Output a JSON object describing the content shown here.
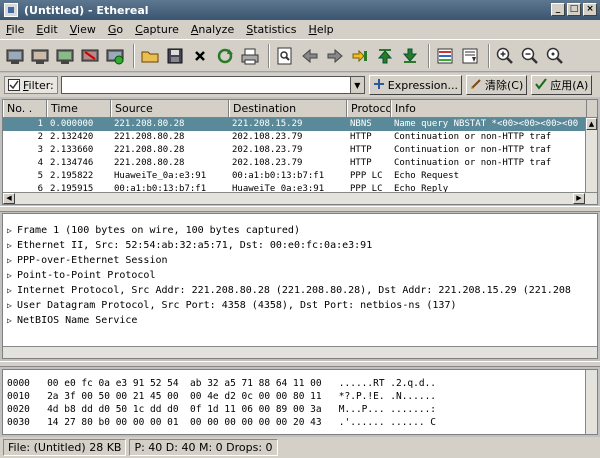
{
  "window": {
    "title": "(Untitled) - Ethereal"
  },
  "menu": [
    {
      "pre": "",
      "key": "F",
      "post": "ile"
    },
    {
      "pre": "",
      "key": "E",
      "post": "dit"
    },
    {
      "pre": "",
      "key": "V",
      "post": "iew"
    },
    {
      "pre": "",
      "key": "G",
      "post": "o"
    },
    {
      "pre": "",
      "key": "C",
      "post": "apture"
    },
    {
      "pre": "",
      "key": "A",
      "post": "nalyze"
    },
    {
      "pre": "",
      "key": "S",
      "post": "tatistics"
    },
    {
      "pre": "",
      "key": "H",
      "post": "elp"
    }
  ],
  "filter": {
    "label_key": "F",
    "label_post": "ilter:",
    "value": "",
    "expression_label": "Expression...",
    "clear_label": "清除(C)",
    "apply_label": "应用(A)"
  },
  "packet_list": {
    "columns": [
      "No. .",
      "Time",
      "Source",
      "Destination",
      "Protocol",
      "Info"
    ],
    "rows": [
      {
        "no": "1",
        "time": "0.000000",
        "src": "221.208.80.28",
        "dst": "221.208.15.29",
        "proto": "NBNS",
        "info": "Name query NBSTAT *<00><00><00><00"
      },
      {
        "no": "2",
        "time": "2.132420",
        "src": "221.208.80.28",
        "dst": "202.108.23.79",
        "proto": "HTTP",
        "info": "Continuation or non-HTTP traf"
      },
      {
        "no": "3",
        "time": "2.133660",
        "src": "221.208.80.28",
        "dst": "202.108.23.79",
        "proto": "HTTP",
        "info": "Continuation or non-HTTP traf"
      },
      {
        "no": "4",
        "time": "2.134746",
        "src": "221.208.80.28",
        "dst": "202.108.23.79",
        "proto": "HTTP",
        "info": "Continuation or non-HTTP traf"
      },
      {
        "no": "5",
        "time": "2.195822",
        "src": "HuaweiTe_0a:e3:91",
        "dst": "00:a1:b0:13:b7:f1",
        "proto": "PPP LC",
        "info": "Echo Request"
      },
      {
        "no": "6",
        "time": "2.195915",
        "src": "00:a1:b0:13:b7:f1",
        "dst": "HuaweiTe_0a:e3:91",
        "proto": "PPP LC",
        "info": "Echo Reply"
      }
    ],
    "selected_index": 0
  },
  "details": [
    "Frame 1 (100 bytes on wire, 100 bytes captured)",
    "Ethernet II, Src: 52:54:ab:32:a5:71, Dst: 00:e0:fc:0a:e3:91",
    "PPP-over-Ethernet Session",
    "Point-to-Point Protocol",
    "Internet Protocol, Src Addr: 221.208.80.28 (221.208.80.28), Dst Addr: 221.208.15.29 (221.208",
    "User Datagram Protocol, Src Port: 4358 (4358), Dst Port: netbios-ns (137)",
    "NetBIOS Name Service"
  ],
  "hex": [
    {
      "offset": "0000",
      "bytes": "00 e0 fc 0a e3 91 52 54  ab 32 a5 71 88 64 11 00",
      "ascii": "......RT .2.q.d.."
    },
    {
      "offset": "0010",
      "bytes": "2a 3f 00 50 00 21 45 00  00 4e d2 0c 00 00 80 11",
      "ascii": "*?.P.!E. .N......"
    },
    {
      "offset": "0020",
      "bytes": "4d b8 dd d0 50 1c dd d0  0f 1d 11 06 00 89 00 3a",
      "ascii": "M...P... .......:"
    },
    {
      "offset": "0030",
      "bytes": "14 27 80 b0 00 00 00 01  00 00 00 00 00 00 20 43",
      "ascii": ".'...... ...... C"
    }
  ],
  "status": {
    "file": "File: (Untitled) 28 KB",
    "counts": "P: 40 D: 40 M: 0 Drops: 0"
  }
}
